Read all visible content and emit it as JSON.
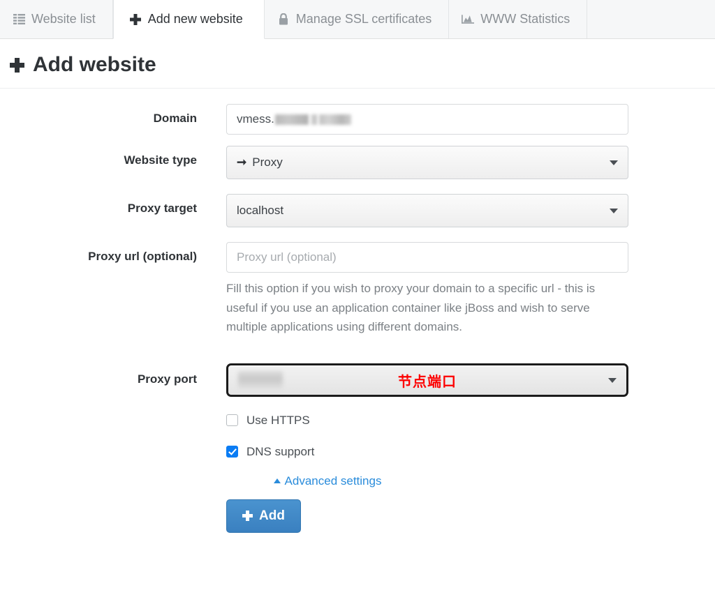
{
  "tabs": [
    {
      "label": "Website list",
      "icon": "list-icon",
      "active": false
    },
    {
      "label": "Add new website",
      "icon": "plus-icon",
      "active": true
    },
    {
      "label": "Manage SSL certificates",
      "icon": "lock-icon",
      "active": false
    },
    {
      "label": "WWW Statistics",
      "icon": "area-chart-icon",
      "active": false
    }
  ],
  "page": {
    "title": "Add website"
  },
  "form": {
    "domain": {
      "label": "Domain",
      "value_prefix": "vmess.",
      "redacted": true
    },
    "website_type": {
      "label": "Website type",
      "selected": "Proxy",
      "icon": "arrow-right-icon"
    },
    "proxy_target": {
      "label": "Proxy target",
      "selected": "localhost"
    },
    "proxy_url": {
      "label": "Proxy url (optional)",
      "value": "",
      "placeholder": "Proxy url (optional)",
      "help": "Fill this option if you wish to proxy your domain to a specific url - this is useful if you use an application container like jBoss and wish to serve multiple applications using different domains."
    },
    "proxy_port": {
      "label": "Proxy port",
      "selected": "",
      "redacted": true,
      "annotation": "节点端口",
      "annotation_color": "#fd0000",
      "highlighted": true
    },
    "use_https": {
      "label": "Use HTTPS",
      "checked": false
    },
    "dns_support": {
      "label": "DNS support",
      "checked": true
    },
    "advanced_settings": {
      "label": "Advanced settings",
      "icon": "caret-up-icon",
      "color": "#2a8cdb"
    },
    "submit": {
      "label": "Add",
      "icon": "plus-icon",
      "color": "#3a80c0"
    }
  }
}
